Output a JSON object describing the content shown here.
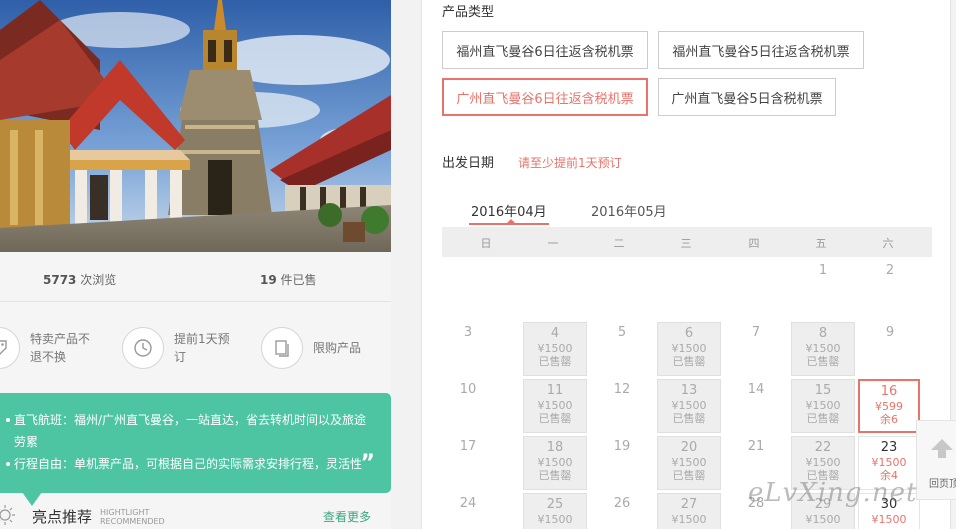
{
  "stats": {
    "views_num": "5773",
    "views_label": "次浏览",
    "sold_num": "19",
    "sold_label": "件已售"
  },
  "features": [
    {
      "icon": "tag-icon",
      "label": "特卖产品不退不换"
    },
    {
      "icon": "clock-icon",
      "label": "提前1天预订"
    },
    {
      "icon": "pages-icon",
      "label": "限购产品"
    }
  ],
  "highlights": {
    "items": [
      "直飞航班：福州/广州直飞曼谷，一站直达，省去转机时间以及旅途劳累",
      "行程自由：单机票产品，可根据自己的实际需求安排行程，灵活性"
    ],
    "quote": "”",
    "title": "亮点推荐",
    "sub_en_1": "HIGHTLIGHT",
    "sub_en_2": "RECOMMENDED",
    "more": "查看更多"
  },
  "product_type": {
    "title": "产品类型",
    "options": [
      {
        "label": "福州直飞曼谷6日往返含税机票",
        "selected": false
      },
      {
        "label": "福州直飞曼谷5日往返含税机票",
        "selected": false
      },
      {
        "label": "广州直飞曼谷6日往返含税机票",
        "selected": true
      },
      {
        "label": "广州直飞曼谷5日含税机票",
        "selected": false
      }
    ]
  },
  "departure": {
    "title": "出发日期",
    "note": "请至少提前1天预订",
    "months": [
      {
        "label": "2016年04月",
        "active": true
      },
      {
        "label": "2016年05月",
        "active": false
      }
    ],
    "weekdays": [
      "日",
      "一",
      "二",
      "三",
      "四",
      "五",
      "六"
    ],
    "cells": [
      {
        "day": "1",
        "col": 5,
        "row": 0,
        "status": "none"
      },
      {
        "day": "2",
        "col": 6,
        "row": 0,
        "status": "none"
      },
      {
        "day": "3",
        "col": 0,
        "row": 1,
        "status": "none"
      },
      {
        "day": "4",
        "col": 1,
        "row": 1,
        "status": "sold",
        "price": "¥1500",
        "stock": "已售罄"
      },
      {
        "day": "5",
        "col": 2,
        "row": 1,
        "status": "none"
      },
      {
        "day": "6",
        "col": 3,
        "row": 1,
        "status": "sold",
        "price": "¥1500",
        "stock": "已售罄"
      },
      {
        "day": "7",
        "col": 4,
        "row": 1,
        "status": "none"
      },
      {
        "day": "8",
        "col": 5,
        "row": 1,
        "status": "sold",
        "price": "¥1500",
        "stock": "已售罄"
      },
      {
        "day": "9",
        "col": 6,
        "row": 1,
        "status": "none"
      },
      {
        "day": "10",
        "col": 0,
        "row": 2,
        "status": "none"
      },
      {
        "day": "11",
        "col": 1,
        "row": 2,
        "status": "sold",
        "price": "¥1500",
        "stock": "已售罄"
      },
      {
        "day": "12",
        "col": 2,
        "row": 2,
        "status": "none"
      },
      {
        "day": "13",
        "col": 3,
        "row": 2,
        "status": "sold",
        "price": "¥1500",
        "stock": "已售罄"
      },
      {
        "day": "14",
        "col": 4,
        "row": 2,
        "status": "none"
      },
      {
        "day": "15",
        "col": 5,
        "row": 2,
        "status": "sold",
        "price": "¥1500",
        "stock": "已售罄"
      },
      {
        "day": "16",
        "col": 6,
        "row": 2,
        "status": "chosen",
        "price": "¥599",
        "stock": "余6"
      },
      {
        "day": "17",
        "col": 0,
        "row": 3,
        "status": "none"
      },
      {
        "day": "18",
        "col": 1,
        "row": 3,
        "status": "sold",
        "price": "¥1500",
        "stock": "已售罄"
      },
      {
        "day": "19",
        "col": 2,
        "row": 3,
        "status": "none"
      },
      {
        "day": "20",
        "col": 3,
        "row": 3,
        "status": "sold",
        "price": "¥1500",
        "stock": "已售罄"
      },
      {
        "day": "21",
        "col": 4,
        "row": 3,
        "status": "none"
      },
      {
        "day": "22",
        "col": 5,
        "row": 3,
        "status": "sold",
        "price": "¥1500",
        "stock": "已售罄"
      },
      {
        "day": "23",
        "col": 6,
        "row": 3,
        "status": "avail",
        "price": "¥1500",
        "stock": "余4"
      },
      {
        "day": "24",
        "col": 0,
        "row": 4,
        "status": "none"
      },
      {
        "day": "25",
        "col": 1,
        "row": 4,
        "status": "sold",
        "price": "¥1500",
        "stock": ""
      },
      {
        "day": "26",
        "col": 2,
        "row": 4,
        "status": "none"
      },
      {
        "day": "27",
        "col": 3,
        "row": 4,
        "status": "sold",
        "price": "¥1500",
        "stock": ""
      },
      {
        "day": "28",
        "col": 4,
        "row": 4,
        "status": "none"
      },
      {
        "day": "29",
        "col": 5,
        "row": 4,
        "status": "sold",
        "price": "¥1500",
        "stock": ""
      },
      {
        "day": "30",
        "col": 6,
        "row": 4,
        "status": "avail",
        "price": "¥1500",
        "stock": ""
      }
    ]
  },
  "back_to_top": "回页顶",
  "watermark": "eLvXing.net"
}
